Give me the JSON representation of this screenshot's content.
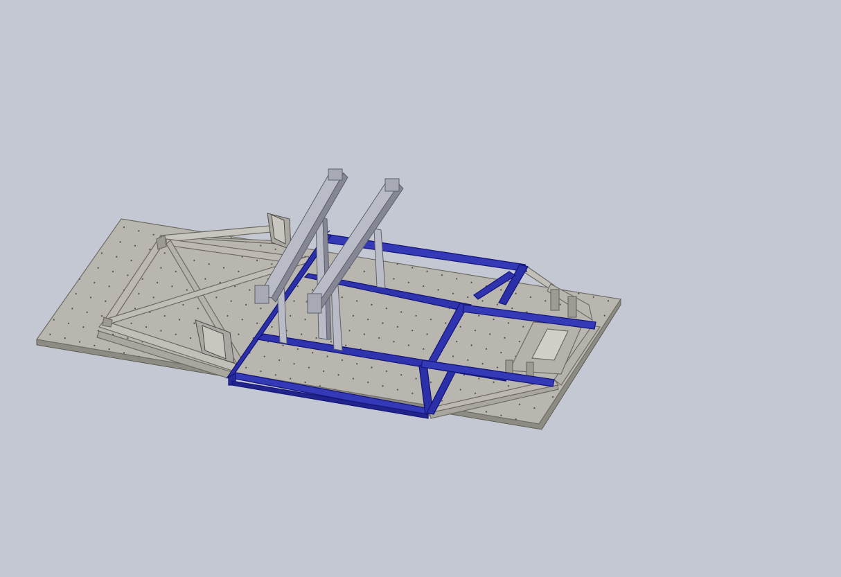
{
  "scene": {
    "background_color": "#c4c8d2",
    "plate_color": "#b8b6ae",
    "plate_edge_color": "#6f6d66",
    "steel_color": "#bdb9b2",
    "steel_shadow_color": "#8a8780",
    "blue_frame_color": "#2b2fa8",
    "blue_frame_highlight": "#4a52d6",
    "rail_color": "#b9bcc6",
    "rail_shadow_color": "#858894",
    "bracket_color": "#a9a7a1"
  }
}
